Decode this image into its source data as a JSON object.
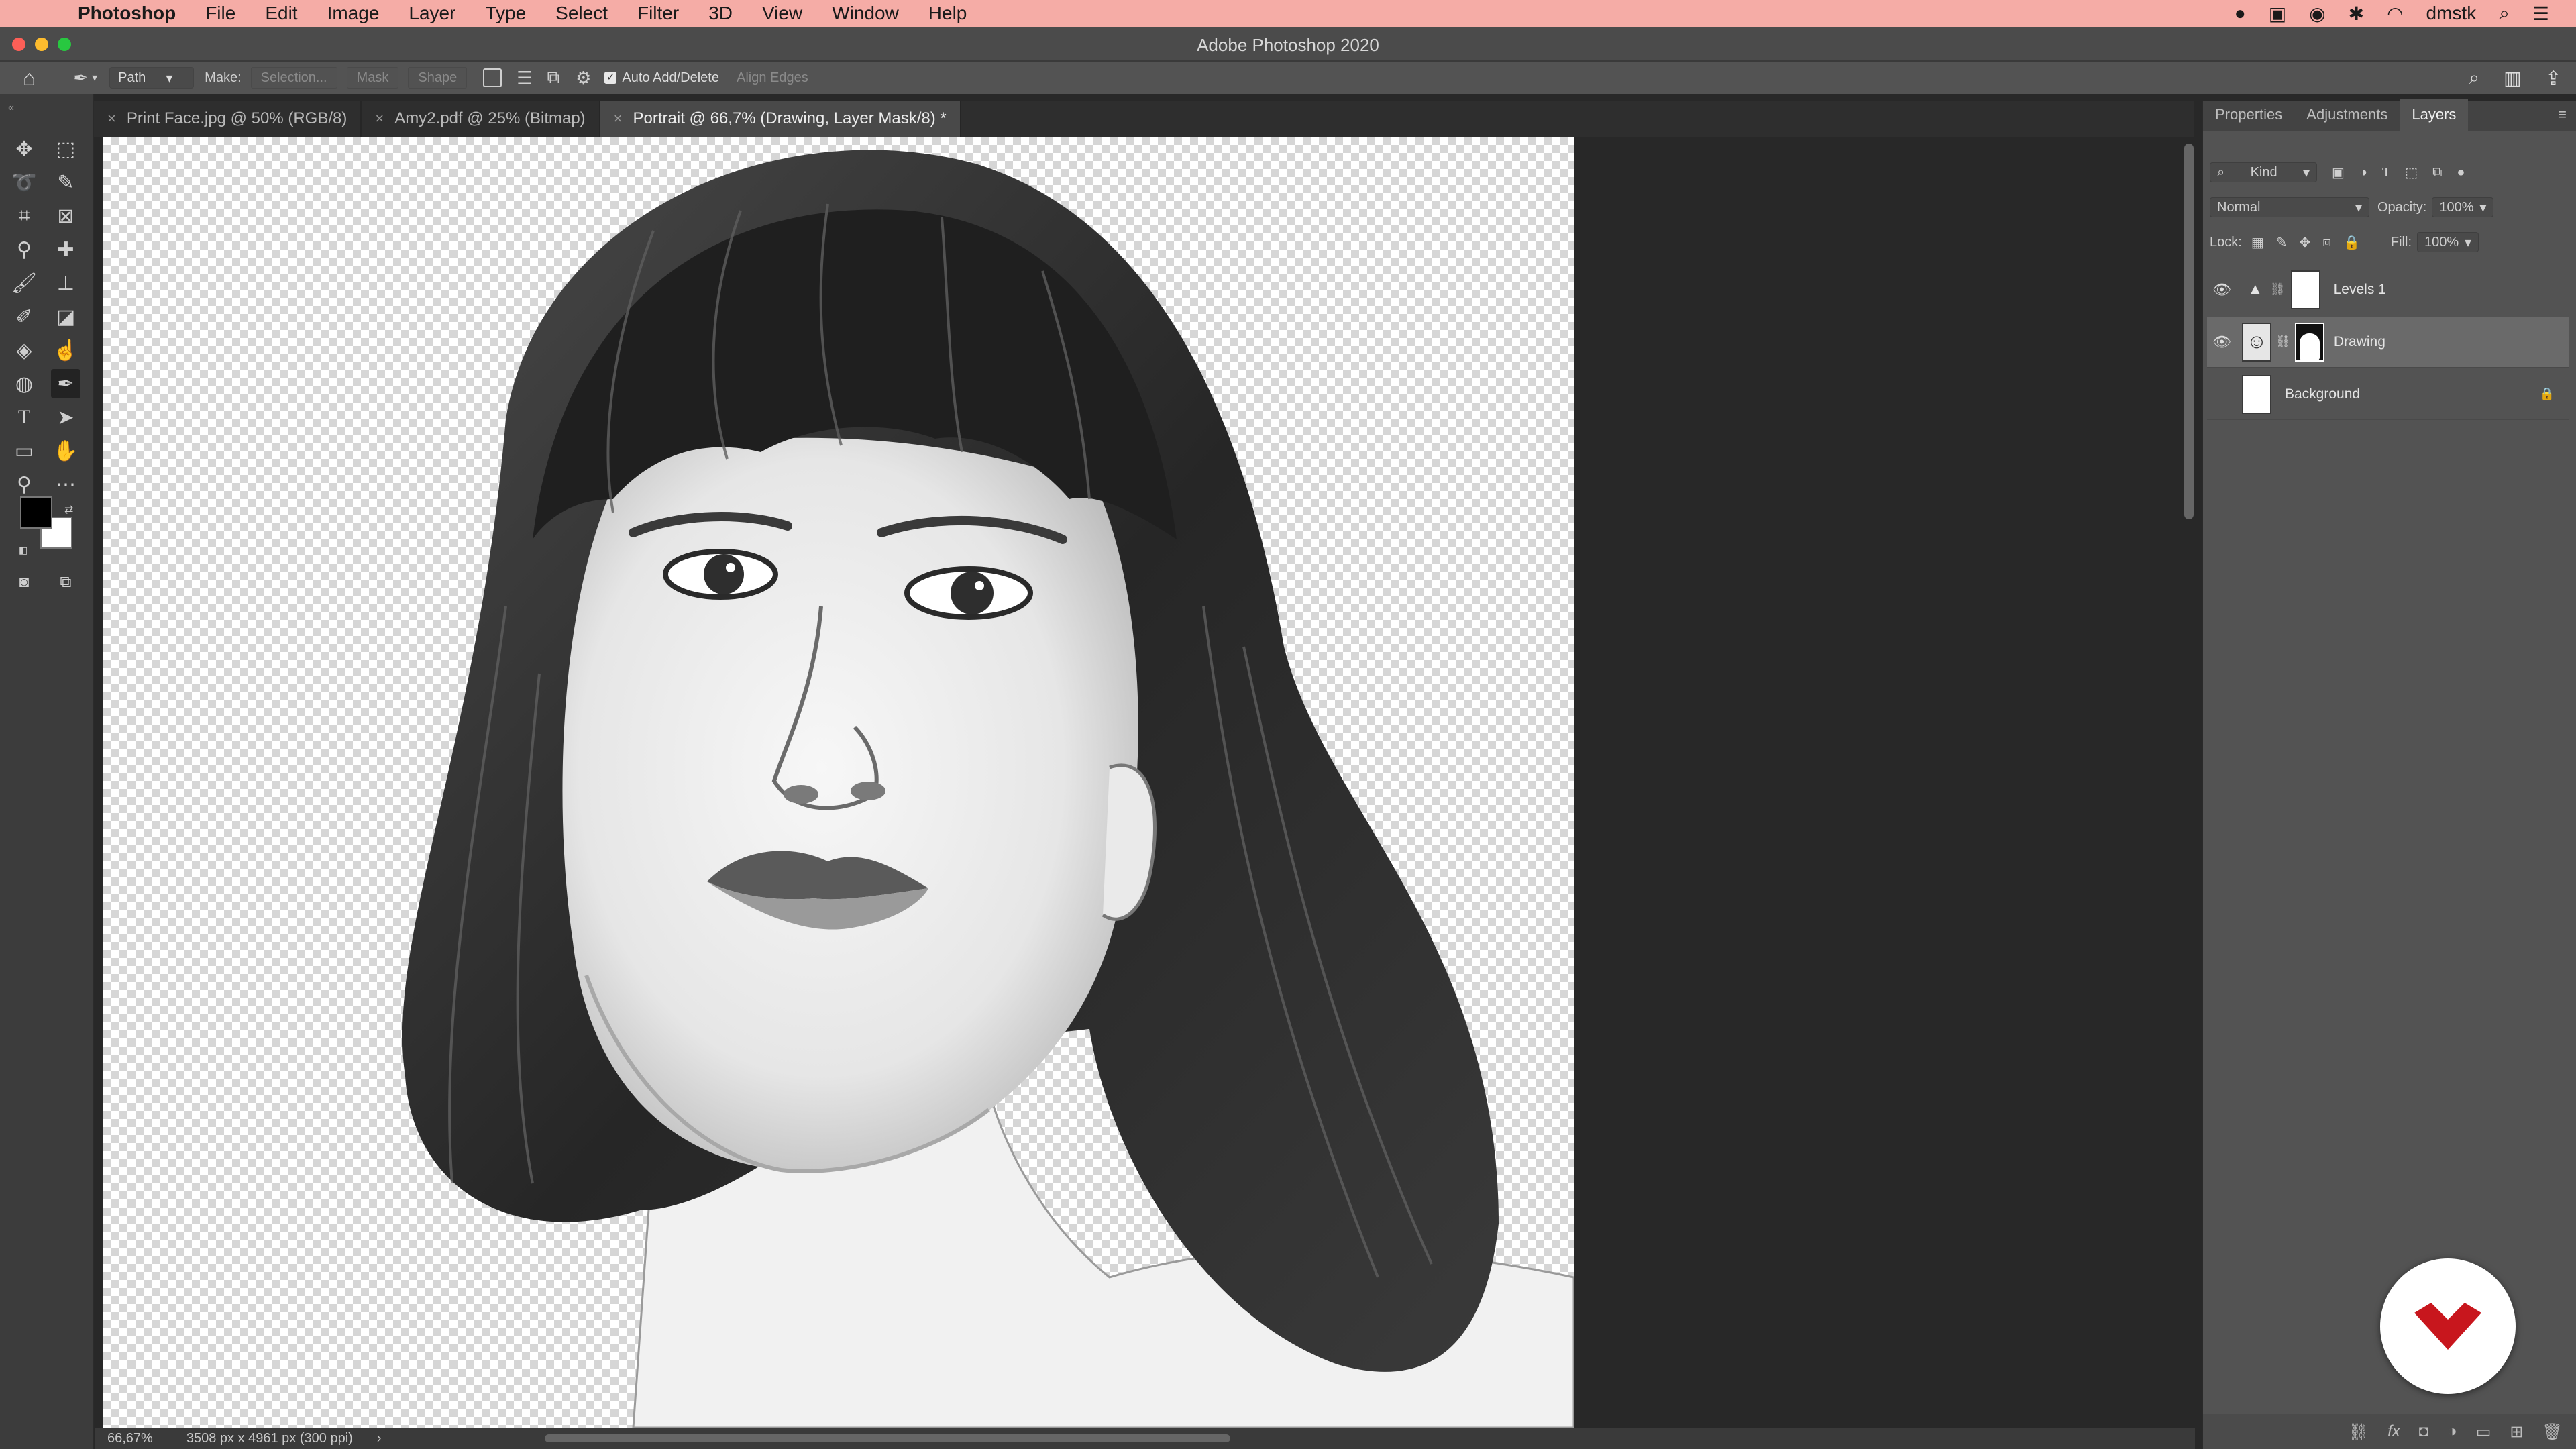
{
  "menubar": {
    "app": "Photoshop",
    "items": [
      "File",
      "Edit",
      "Image",
      "Layer",
      "Type",
      "Select",
      "Filter",
      "3D",
      "View",
      "Window",
      "Help"
    ],
    "user": "dmstk"
  },
  "window": {
    "title": "Adobe Photoshop 2020"
  },
  "options": {
    "mode": "Path",
    "make_label": "Make:",
    "selection_btn": "Selection...",
    "mask_btn": "Mask",
    "shape_btn": "Shape",
    "auto_add_delete": "Auto Add/Delete",
    "align_edges": "Align Edges"
  },
  "tabs": [
    {
      "label": "Print Face.jpg @ 50% (RGB/8)"
    },
    {
      "label": "Amy2.pdf @ 25% (Bitmap)"
    },
    {
      "label": "Portrait @ 66,7% (Drawing, Layer Mask/8) *",
      "active": true
    }
  ],
  "status": {
    "zoom": "66,67%",
    "doc_info": "3508 px x 4961 px (300 ppi)",
    "arrow": "›"
  },
  "panel": {
    "tabs": [
      "Properties",
      "Adjustments",
      "Layers"
    ],
    "active_tab": "Layers",
    "kind_label": "Kind",
    "blend_mode": "Normal",
    "opacity_label": "Opacity:",
    "opacity": "100%",
    "lock_label": "Lock:",
    "fill_label": "Fill:",
    "fill": "100%",
    "layers": [
      {
        "name": "Levels 1",
        "visible": true
      },
      {
        "name": "Drawing",
        "visible": true,
        "selected": true
      },
      {
        "name": "Background",
        "visible": false,
        "locked": true
      }
    ]
  },
  "colors": {
    "menubar": "#f5aca6",
    "logo_red": "#c8161d"
  }
}
